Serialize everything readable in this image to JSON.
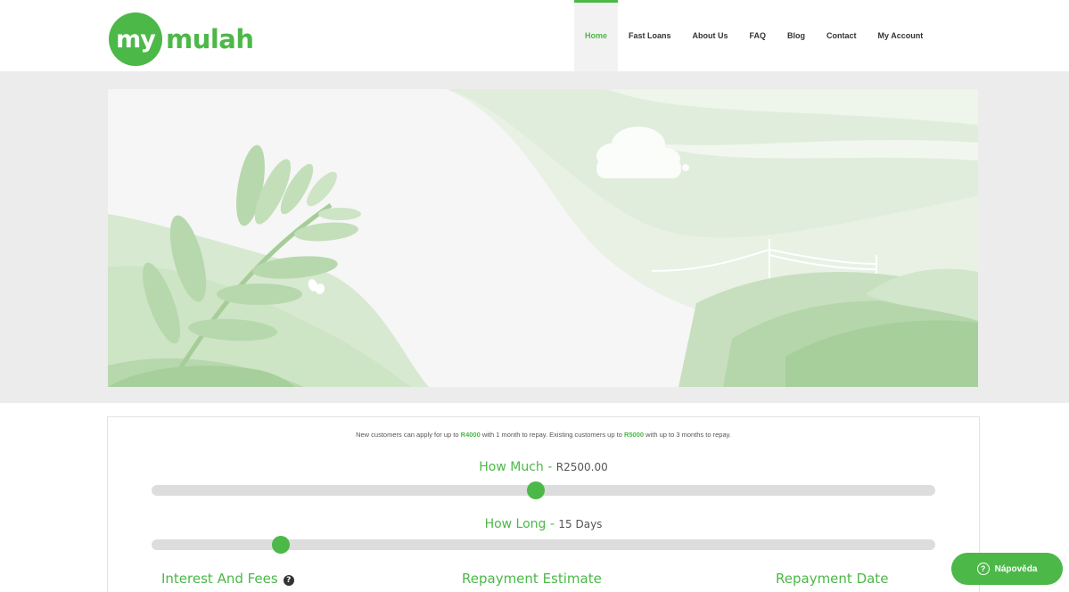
{
  "brand": {
    "logo_circle_text": "my",
    "logo_word": "mulah",
    "colors": {
      "accent": "#4cb848",
      "text": "#333333",
      "muted": "#555555"
    }
  },
  "nav": {
    "items": [
      {
        "label": "Home",
        "active": true
      },
      {
        "label": "Fast Loans",
        "active": false
      },
      {
        "label": "About Us",
        "active": false
      },
      {
        "label": "FAQ",
        "active": false
      },
      {
        "label": "Blog",
        "active": false
      },
      {
        "label": "Contact",
        "active": false
      },
      {
        "label": "My Account",
        "active": false
      }
    ]
  },
  "calculator": {
    "intro": {
      "part1": "New customers can apply for up to ",
      "amount1": "R4000",
      "part2": " with 1 month to repay. Existing customers up to ",
      "amount2": "R5000",
      "part3": " with up to 3 months to repay."
    },
    "amount": {
      "label": "How Much",
      "separator": " - ",
      "value": "R2500.00",
      "level": 0.49
    },
    "duration": {
      "label": "How Long",
      "separator": " - ",
      "value": "15 Days",
      "level": 0.165
    },
    "results": {
      "interest_label": "Interest And Fees",
      "estimate_label": "Repayment Estimate",
      "date_label": "Repayment Date",
      "info_icon": "question-circle-icon"
    }
  },
  "help": {
    "label": "Nápověda",
    "icon": "question-circle-icon"
  }
}
